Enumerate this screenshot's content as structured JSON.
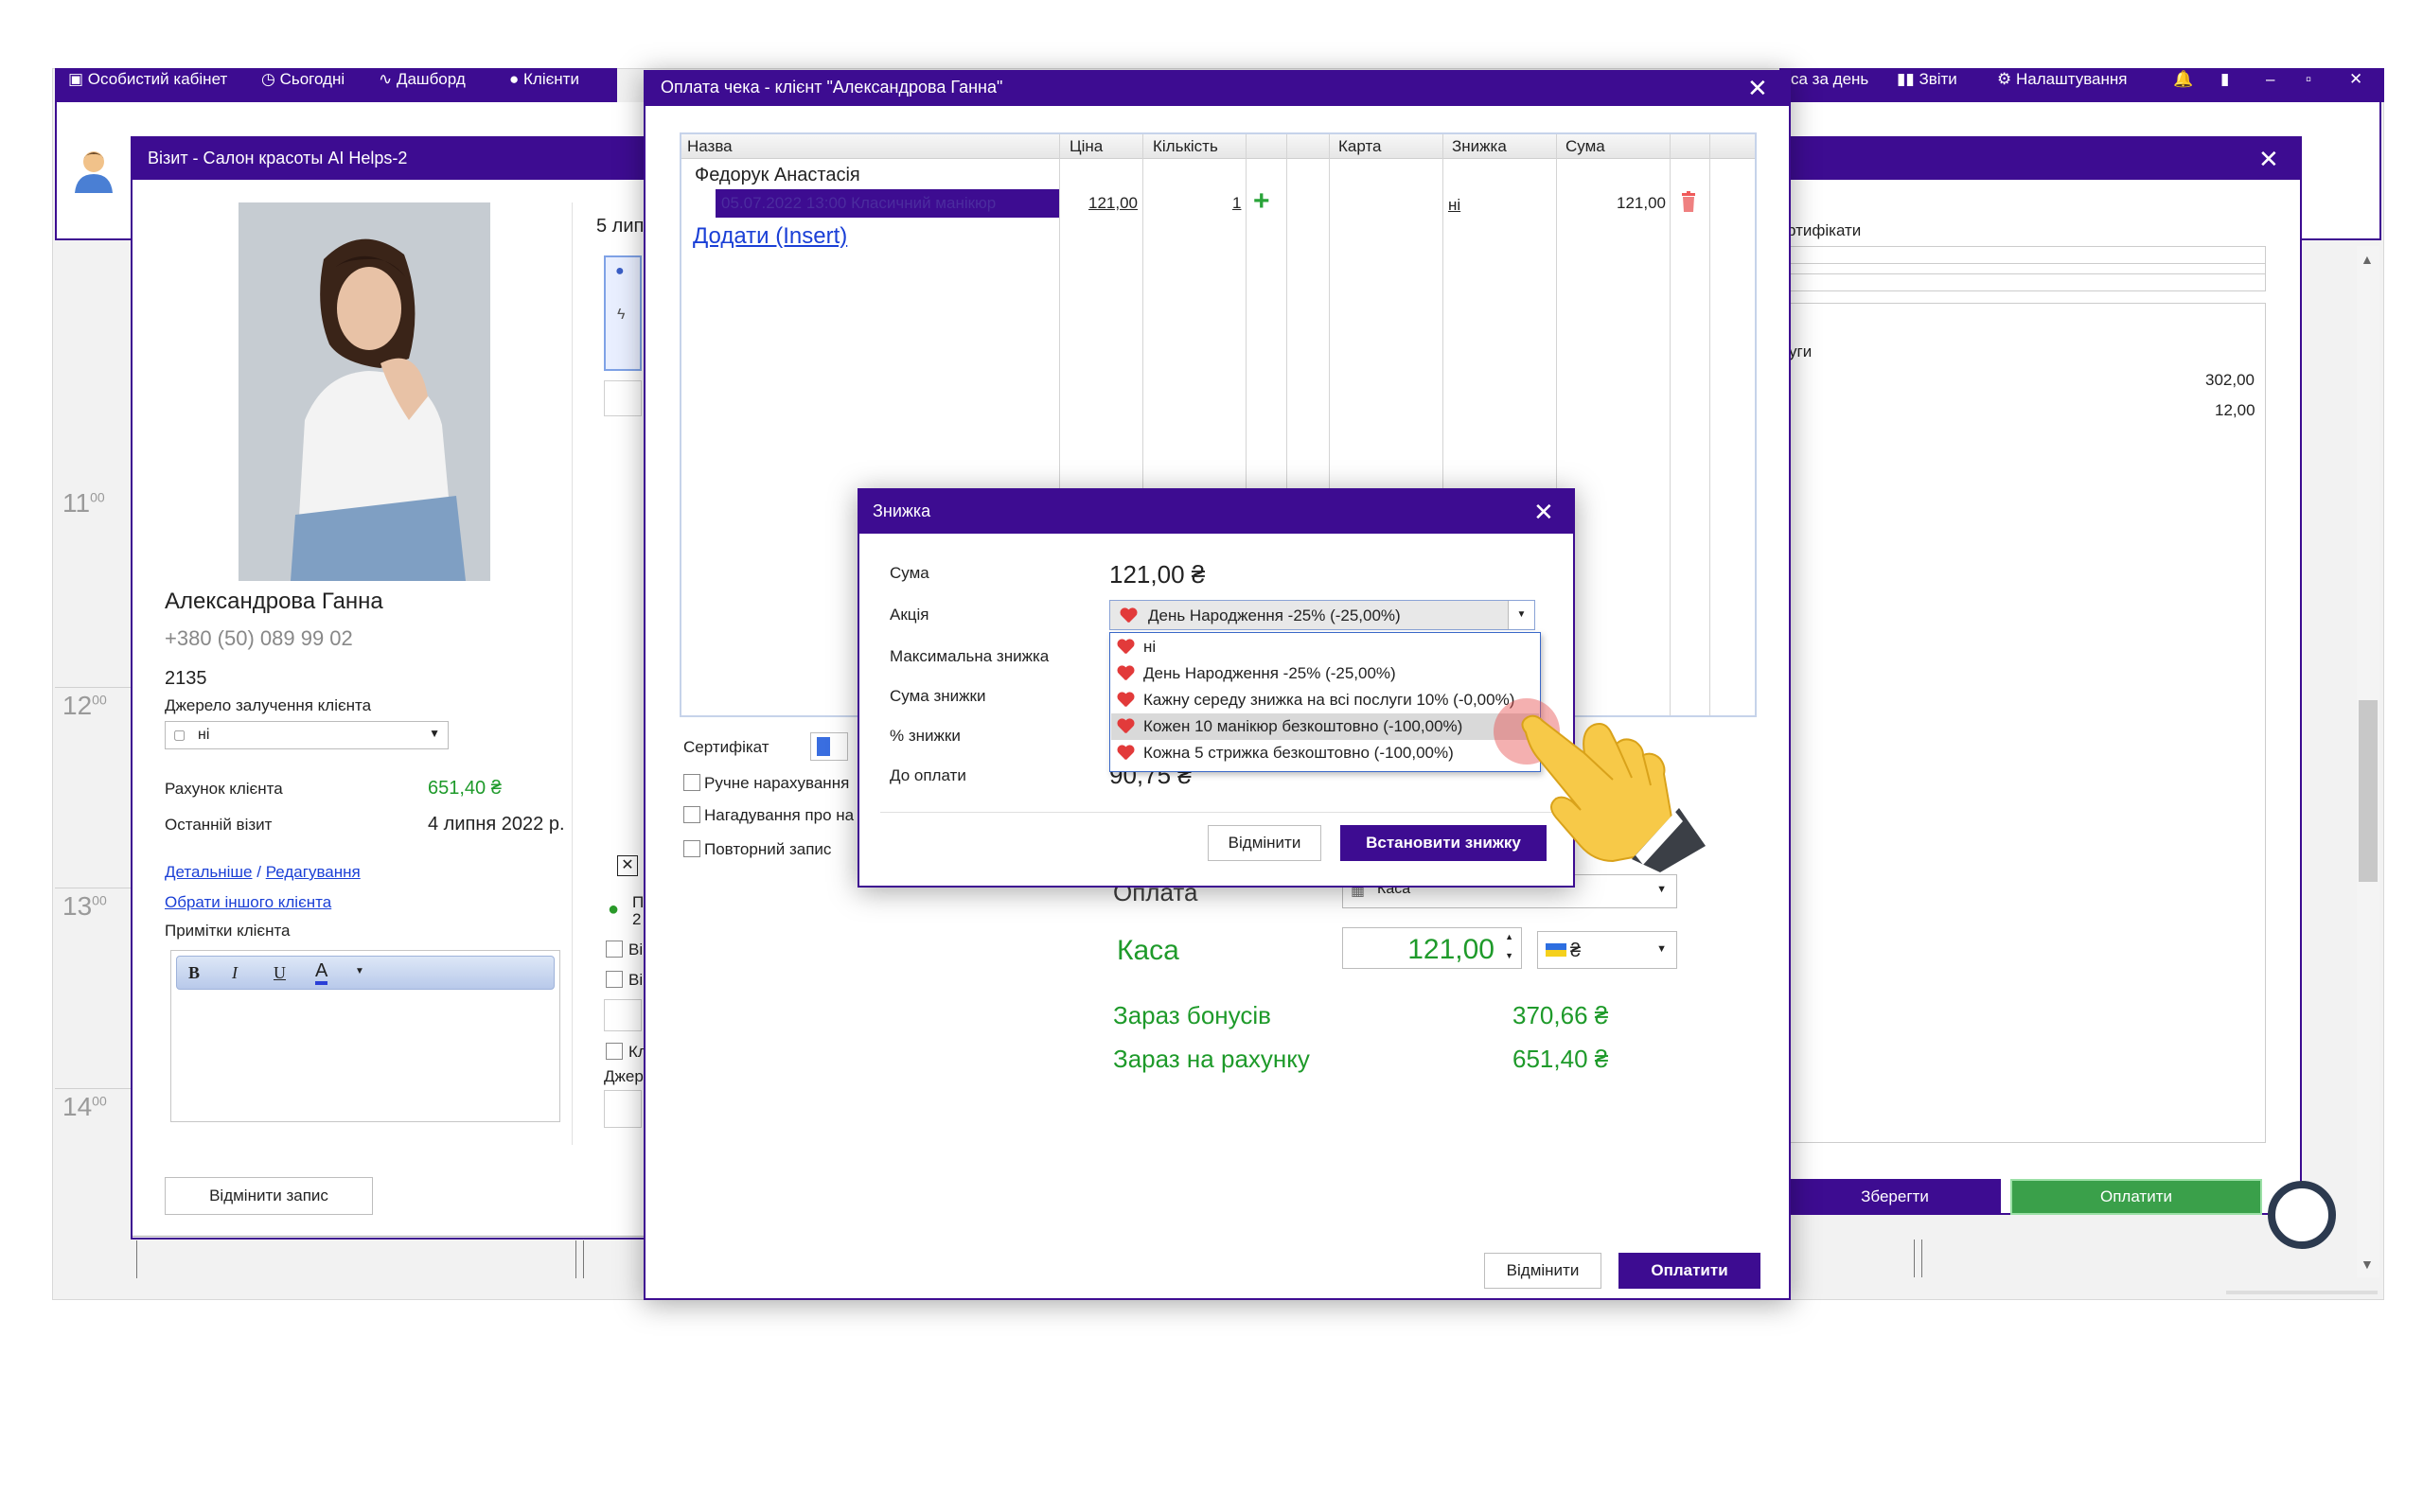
{
  "toolbar_left": {
    "cabinet": "Особистий кабінет",
    "today": "Сьогодні",
    "dashboard": "Дашборд",
    "clients": "Клієнти"
  },
  "toolbar_right": {
    "cash_day": "са за день",
    "reports": "Звіти",
    "settings": "Налаштування"
  },
  "schedule": {
    "times": [
      "11",
      "12",
      "13",
      "14"
    ],
    "minutes": "00"
  },
  "visit": {
    "title": "Візит - Салон красоты AI Helps-2",
    "client_name": "Александрова Ганна",
    "phone": "+380 (50) 089 99 02",
    "code": "2135",
    "source_label": "Джерело залучення клієнта",
    "source_value": "ні",
    "account_label": "Рахунок клієнта",
    "account_value": "651,40 ₴",
    "last_visit_label": "Останній візит",
    "last_visit_value": "4 липня 2022 р.",
    "details_link": "Детальніше",
    "separator": "/",
    "edit_link": "Редагування",
    "choose_other_link": "Обрати іншого клієнта",
    "notes_label": "Примітки клієнта",
    "cancel_record_button": "Відмінити запис",
    "side_text": "5 лип",
    "side_labels": [
      "П",
      "2",
      "Ві",
      "Ві",
      "Кл",
      "Джер"
    ]
  },
  "background_right": {
    "certificates_label": "ртифікати",
    "services_label": "уги",
    "value1": "302,00",
    "value2": "12,00",
    "save_button": "Зберегти",
    "pay_button": "Оплатити"
  },
  "payment": {
    "title": "Оплата чека - клієнт \"Александрова Ганна\"",
    "columns": [
      "Назва",
      "Ціна",
      "Кількість",
      "Карта",
      "Знижка",
      "Сума"
    ],
    "master": "Федорук Анастасія",
    "item_text": "05.07.2022 13:00 Класичний манікюр",
    "item_price": "121,00",
    "item_qty": "1",
    "item_discount": "ні",
    "item_sum": "121,00",
    "add_link": "Додати (Insert)",
    "certificate_label": "Сертифікат",
    "manual_label": "Ручне нарахування",
    "reminder_label": "Нагадування про на",
    "repeat_label": "Повторний запис",
    "payment_label": "Оплата",
    "payment_method": "Каса",
    "kasa_label": "Каса",
    "kasa_amount": "121,00",
    "currency": "₴",
    "bonus_label": "Зараз бонусів",
    "bonus_value": "370,66 ₴",
    "account_label": "Зараз на рахунку",
    "account_value": "651,40 ₴",
    "cancel_button": "Відмінити",
    "pay_button": "Оплатити"
  },
  "discount": {
    "title": "Знижка",
    "sum_label": "Сума",
    "sum_value": "121,00 ₴",
    "promo_label": "Акція",
    "promo_selected": "День Народження -25% (-25,00%)",
    "max_label": "Максимальна знижка",
    "discount_sum_label": "Сума знижки",
    "percent_label": "% знижки",
    "to_pay_label": "До оплати",
    "to_pay_value": "90,75 ₴",
    "options": [
      "ні",
      "День Народження -25% (-25,00%)",
      "Кажну середу знижка на всі послуги 10% (-0,00%)",
      "Кожен 10 манікюр безкоштовно (-100,00%)",
      "Кожна 5 стрижка безкоштовно (-100,00%)"
    ],
    "cancel_button": "Відмінити",
    "apply_button": "Встановити знижку"
  },
  "colors": {
    "brand_purple": "#3d0c91",
    "green_text": "#1e9a2a",
    "button_green": "#3aa04a",
    "heart_red": "#e23a3a"
  }
}
